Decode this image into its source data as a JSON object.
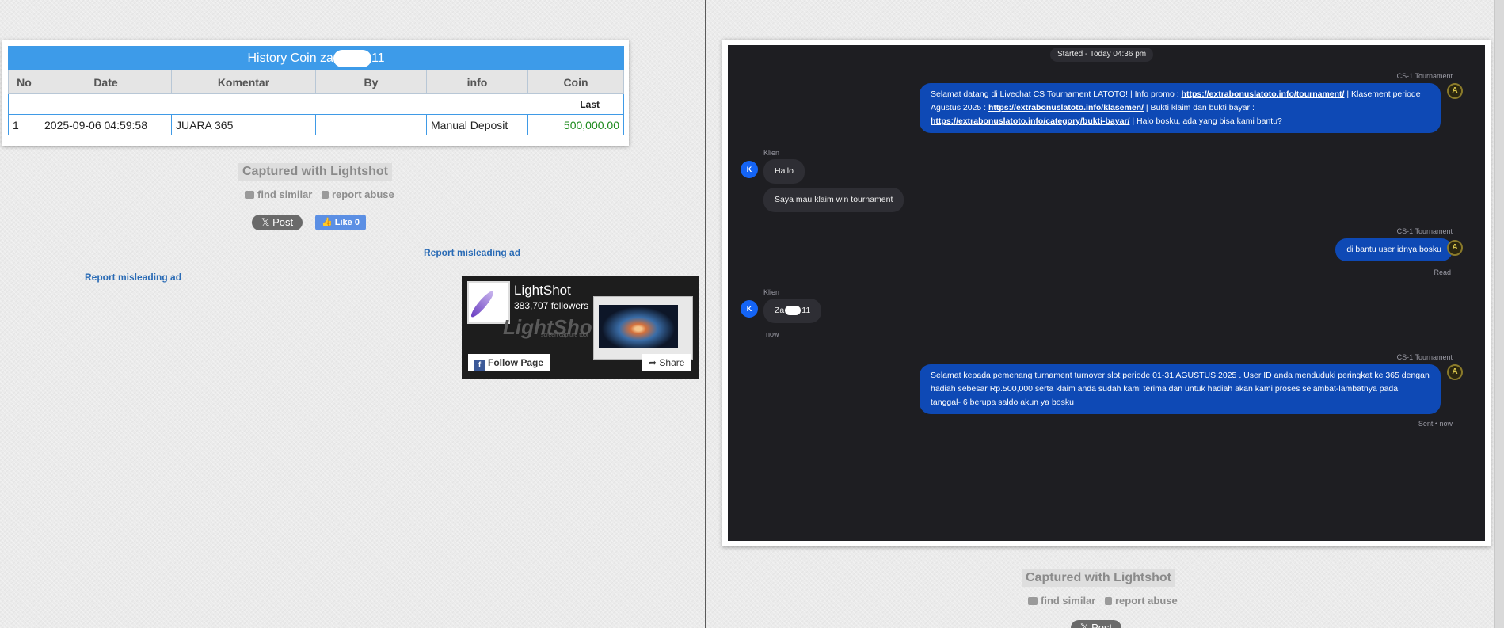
{
  "left": {
    "history": {
      "title_prefix": "History Coin za",
      "title_suffix": "11",
      "columns": [
        "No",
        "Date",
        "Komentar",
        "By",
        "info",
        "Coin"
      ],
      "sort_label": "Last",
      "rows": [
        {
          "no": "1",
          "date": "2025-09-06 04:59:58",
          "komentar": "JUARA 365",
          "by": "",
          "info": "Manual Deposit",
          "coin": "500,000.00"
        }
      ]
    },
    "lightshot": {
      "captured": "Captured with Lightshot",
      "find_similar": "find similar",
      "report_abuse": "report abuse",
      "post": "Post",
      "like": "Like 0"
    },
    "report_links": [
      "Report misleading ad",
      "Report misleading ad"
    ],
    "fb_widget": {
      "name": "LightShot",
      "followers": "383,707 followers",
      "ghost_logo": "LightShot",
      "ghost_sub": "screen capture tool",
      "follow": "Follow Page",
      "share": "Share"
    }
  },
  "right": {
    "chat": {
      "started": "Started - Today 04:36 pm",
      "agent_name": "CS-1 Tournament",
      "client_name": "Klien",
      "client_initial": "K",
      "agent_initial": "A",
      "msg1": {
        "t1": "Selamat datang di Livechat CS Tournament LATOTO! | Info promo : ",
        "link1": "https://extrabonuslatoto.info/tournament/",
        "t2": " | Klasement periode Agustus 2025 : ",
        "link2": "https://extrabonuslatoto.info/klasemen/",
        "t3": " | Bukti klaim dan bukti bayar : ",
        "link3": "https://extrabonuslatoto.info/category/bukti-bayar/",
        "t4": " | Halo bosku, ada yang bisa kami bantu?"
      },
      "client_msg1": "Hallo",
      "client_msg2": "Saya mau klaim win tournament",
      "agent_msg2": "di bantu user idnya bosku",
      "read_label": "Read",
      "client_msg3_prefix": "Za",
      "client_msg3_suffix": "11",
      "now_label": "now",
      "agent_msg3": "Selamat kepada pemenang turnament turnover slot periode 01-31 AGUSTUS 2025 . User ID anda menduduki peringkat ke 365 dengan hadiah sebesar Rp.500,000 serta klaim anda sudah kami terima dan untuk hadiah akan kami proses selambat-lambatnya pada tanggal- 6 berupa saldo akun ya bosku",
      "sent_label": "Sent • now"
    },
    "lightshot": {
      "captured": "Captured with Lightshot",
      "find_similar": "find similar",
      "report_abuse": "report abuse",
      "post": "Post"
    }
  },
  "colors": {
    "table_header": "#3d9be9",
    "coin_value": "#1c8a1c",
    "chat_bg": "#1e1e22",
    "agent_bubble": "#0e49b5",
    "client_bubble": "#2e2e34",
    "client_avatar": "#1464f5",
    "link": "#2a6bb5"
  },
  "icons": {
    "find_similar": "camera-icon",
    "report_abuse": "clipboard-icon",
    "post": "x-logo-icon",
    "like": "thumbs-up-icon",
    "share": "share-arrow-icon",
    "follow": "facebook-icon"
  }
}
